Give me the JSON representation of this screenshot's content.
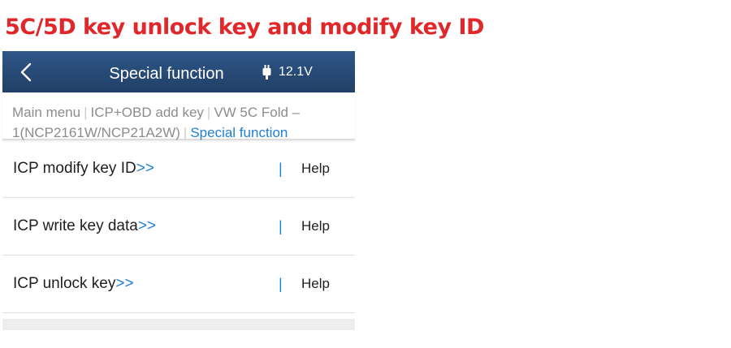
{
  "page": {
    "heading": "5C/5D key unlock key and modify key ID"
  },
  "app": {
    "title": "Special function",
    "voltage": "12.1V",
    "back_icon": "chevron-left-icon",
    "battery_icon": "battery-plug-icon"
  },
  "breadcrumb": {
    "items": [
      {
        "label": "Main menu"
      },
      {
        "label": "ICP+OBD add key"
      },
      {
        "label": "VW 5C Fold –1(NCP2161W/NCP21A2W)"
      },
      {
        "label": "Special function"
      }
    ],
    "separator": "|"
  },
  "menu": {
    "items": [
      {
        "label": "ICP modify key ID",
        "arrow": ">>",
        "help": "Help"
      },
      {
        "label": "ICP write key data",
        "arrow": ">>",
        "help": "Help"
      },
      {
        "label": "ICP unlock key",
        "arrow": ">>",
        "help": "Help"
      }
    ],
    "help_separator": "|"
  },
  "colors": {
    "heading": "#e0282b",
    "header_bg": "#2a4d7a",
    "accent": "#1f7fd4",
    "text": "#1e1e1e",
    "muted": "#8c8c8c"
  }
}
